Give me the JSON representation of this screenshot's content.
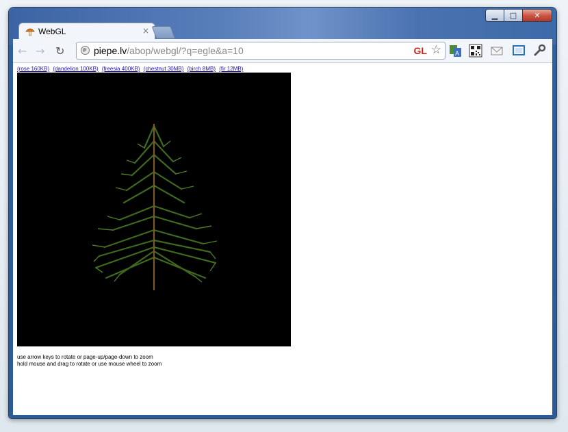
{
  "tab": {
    "title": "WebGL",
    "close": "×"
  },
  "window": {
    "min": "▁",
    "max": "□",
    "close": "✕"
  },
  "toolbar": {
    "back": "←",
    "forward": "→",
    "reload": "↻",
    "url_host": "piepe.lv",
    "url_path": "/abop/webgl/?q=egle&a=10",
    "gl_badge": "GL",
    "star": "☆"
  },
  "models": [
    "(rose 160KB)",
    "(dandelion 100KB)",
    "(freesia 400KB)",
    "(chestnut 30MB)",
    "(birch 8MB)",
    "(fir 12MB)"
  ],
  "help": {
    "line1": "use arrow keys to rotate or page-up/page-down to zoom",
    "line2": "hold mouse and drag to rotate or use mouse wheel to zoom"
  },
  "colors": {
    "canvas_bg": "#000000",
    "tree_green": "#3f6a1e",
    "trunk": "#7a5a2a",
    "link": "#1a0dab"
  }
}
